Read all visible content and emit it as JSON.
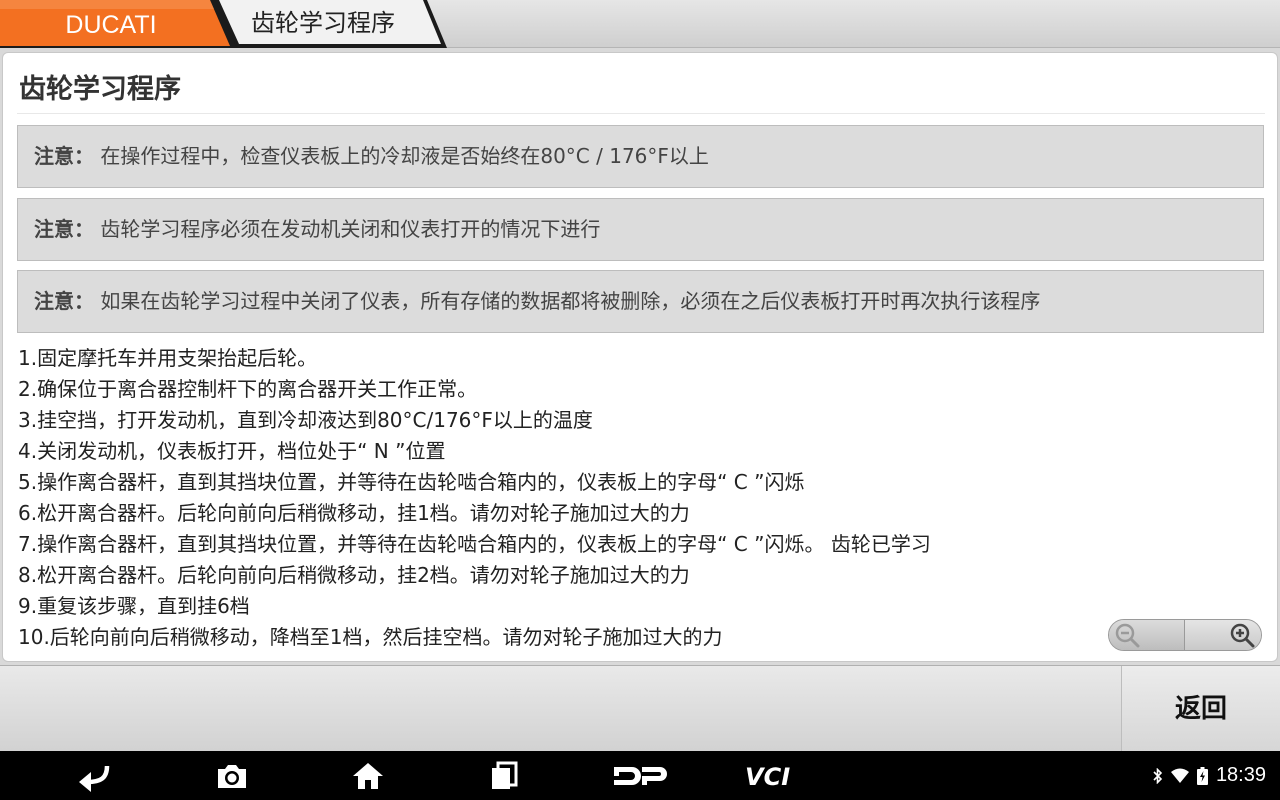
{
  "breadcrumb": {
    "brand": "DUCATI",
    "page": "齿轮学习程序"
  },
  "colors": {
    "brand_orange": "#f37021",
    "note_bg": "#dcdcdc"
  },
  "panel": {
    "title": "齿轮学习程序",
    "notes": [
      {
        "label": "注意：",
        "text": "在操作过程中，检查仪表板上的冷却液是否始终在80°C / 176°F以上"
      },
      {
        "label": "注意：",
        "text": "齿轮学习程序必须在发动机关闭和仪表打开的情况下进行"
      },
      {
        "label": "注意：",
        "text": "如果在齿轮学习过程中关闭了仪表，所有存储的数据都将被删除，必须在之后仪表板打开时再次执行该程序"
      }
    ],
    "steps": [
      "1.固定摩托车并用支架抬起后轮。",
      "2.确保位于离合器控制杆下的离合器开关工作正常。",
      "3.挂空挡，打开发动机，直到冷却液达到80°C/176°F以上的温度",
      "4.关闭发动机，仪表板打开，档位处于“ N ”位置",
      "5.操作离合器杆，直到其挡块位置，并等待在齿轮啮合箱内的，仪表板上的字母“ C ”闪烁",
      "6.松开离合器杆。后轮向前向后稍微移动，挂1档。请勿对轮子施加过大的力",
      "7.操作离合器杆，直到其挡块位置，并等待在齿轮啮合箱内的，仪表板上的字母“ C ”闪烁。 齿轮已学习",
      "8.松开离合器杆。后轮向前向后稍微移动，挂2档。请勿对轮子施加过大的力",
      "9.重复该步骤，直到挂6档",
      "10.后轮向前向后稍微移动，降档至1档，然后挂空档。请勿对轮子施加过大的力"
    ]
  },
  "zoom": {
    "out_icon": "zoom-out-icon",
    "in_icon": "zoom-in-icon"
  },
  "actions": {
    "back_label": "返回"
  },
  "navbar": {
    "icons": [
      "back-arrow-icon",
      "camera-icon",
      "home-icon",
      "recent-apps-icon",
      "dp-icon",
      "vci-icon"
    ],
    "dp_label": "DP",
    "vci_label": "VCI"
  },
  "status": {
    "time": "18:39",
    "icons": [
      "bluetooth-icon",
      "wifi-icon",
      "battery-icon"
    ]
  }
}
